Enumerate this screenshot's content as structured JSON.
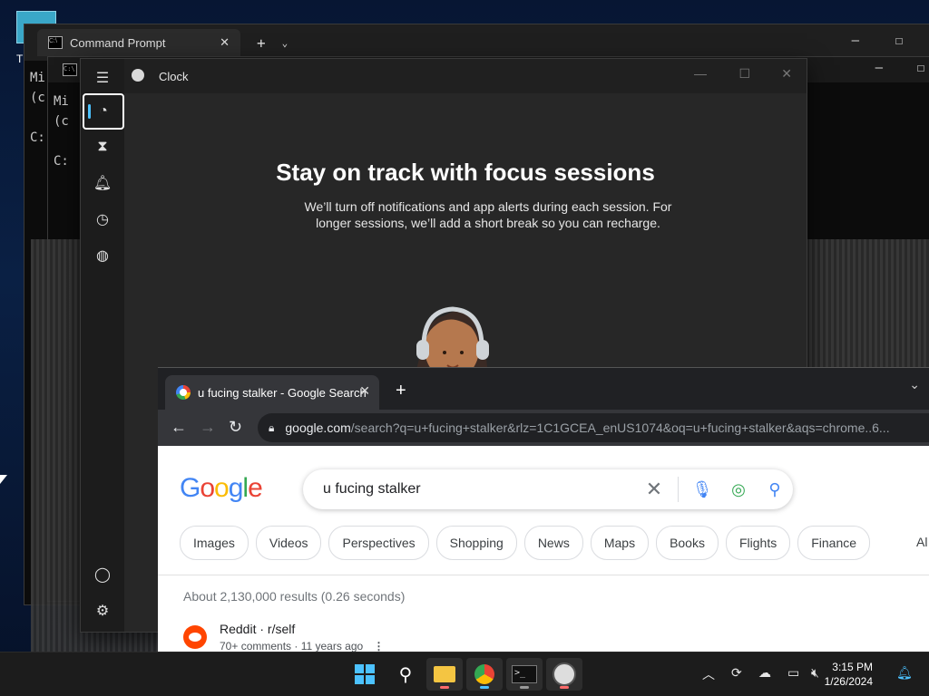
{
  "desktop": {
    "label": "T"
  },
  "cmd_back": {
    "tab_title": "Command Prompt",
    "lines": [
      "Mi",
      "(c",
      "",
      "C:"
    ],
    "lines2": [
      "Mi",
      "(c",
      "",
      "C:"
    ]
  },
  "clock": {
    "app_title": "Clock",
    "nav": [
      "focus-sessions",
      "timer",
      "alarm",
      "stopwatch",
      "world-clock"
    ],
    "headline": "Stay on track with focus sessions",
    "subline": "We’ll turn off notifications and app alerts during each session. For longer sessions, we’ll add a short break so you can recharge."
  },
  "chrome": {
    "tab_title": "u fucing stalker - Google Search",
    "url_domain": "google.com",
    "url_rest": "/search?q=u+fucing+stalker&rlz=1C1GCEA_enUS1074&oq=u+fucing+stalker&aqs=chrome..6..."
  },
  "google": {
    "logo": "Google",
    "query": "u fucing stalker",
    "chips": [
      "Images",
      "Videos",
      "Perspectives",
      "Shopping",
      "News",
      "Maps",
      "Books",
      "Flights",
      "Finance"
    ],
    "chip_more": "Al",
    "stats": "About 2,130,000 results (0.26 seconds)",
    "result": {
      "site": "Reddit · r/self",
      "meta": "70+ comments · 11 years ago"
    }
  },
  "taskbar": {
    "time": "3:15 PM",
    "date": "1/26/2024"
  },
  "colors": {
    "accent": "#4cc2ff",
    "chrome_dark": "#35363a",
    "google_blue": "#4285f4"
  }
}
